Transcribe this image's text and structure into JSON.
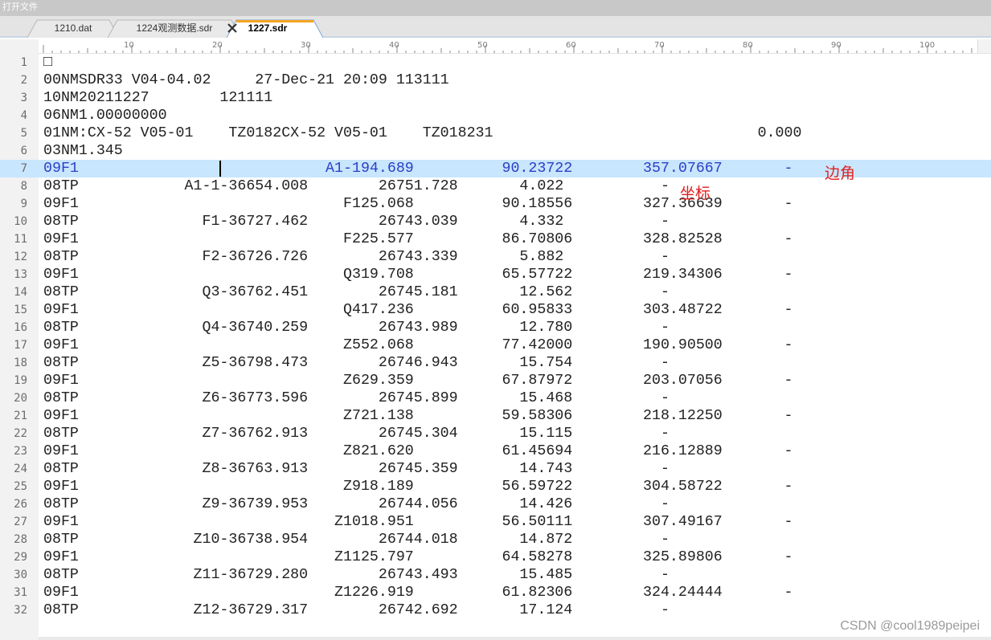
{
  "window": {
    "title": "打开文件"
  },
  "tabs": [
    {
      "label": "1210.dat",
      "active": false
    },
    {
      "label": "1224观测数据.sdr",
      "active": false
    },
    {
      "label": "1227.sdr",
      "active": true
    }
  ],
  "ruler": {
    "labels": [
      "10",
      "20",
      "30",
      "40",
      "50",
      "60",
      "70",
      "80",
      "90",
      "100"
    ]
  },
  "editor": {
    "current_line": 7,
    "lines": [
      {
        "num": "1",
        "text": "□"
      },
      {
        "num": "2",
        "text": "00NMSDR33 V04-04.02     27-Dec-21 20:09 113111"
      },
      {
        "num": "3",
        "text": "10NM20211227        121111"
      },
      {
        "num": "4",
        "text": "06NM1.00000000"
      },
      {
        "num": "5",
        "text": "01NM:CX-52 V05-01    TZ0182CX-52 V05-01    TZ018231                              0.000"
      },
      {
        "num": "6",
        "text": "03NM1.345"
      },
      {
        "num": "7",
        "text": "09F1                            A1-194.689          90.23722        357.07667       -"
      },
      {
        "num": "8",
        "text": "08TP            A1-1-36654.008        26751.728       4.022           -"
      },
      {
        "num": "9",
        "text": "09F1                              F125.068          90.18556        327.36639       -"
      },
      {
        "num": "10",
        "text": "08TP              F1-36727.462        26743.039       4.332           -"
      },
      {
        "num": "11",
        "text": "09F1                              F225.577          86.70806        328.82528       -"
      },
      {
        "num": "12",
        "text": "08TP              F2-36726.726        26743.339       5.882           -"
      },
      {
        "num": "13",
        "text": "09F1                              Q319.708          65.57722        219.34306       -"
      },
      {
        "num": "14",
        "text": "08TP              Q3-36762.451        26745.181       12.562          -"
      },
      {
        "num": "15",
        "text": "09F1                              Q417.236          60.95833        303.48722       -"
      },
      {
        "num": "16",
        "text": "08TP              Q4-36740.259        26743.989       12.780          -"
      },
      {
        "num": "17",
        "text": "09F1                              Z552.068          77.42000        190.90500       -"
      },
      {
        "num": "18",
        "text": "08TP              Z5-36798.473        26746.943       15.754          -"
      },
      {
        "num": "19",
        "text": "09F1                              Z629.359          67.87972        203.07056       -"
      },
      {
        "num": "20",
        "text": "08TP              Z6-36773.596        26745.899       15.468          -"
      },
      {
        "num": "21",
        "text": "09F1                              Z721.138          59.58306        218.12250       -"
      },
      {
        "num": "22",
        "text": "08TP              Z7-36762.913        26745.304       15.115          -"
      },
      {
        "num": "23",
        "text": "09F1                              Z821.620          61.45694        216.12889       -"
      },
      {
        "num": "24",
        "text": "08TP              Z8-36763.913        26745.359       14.743          -"
      },
      {
        "num": "25",
        "text": "09F1                              Z918.189          56.59722        304.58722       -"
      },
      {
        "num": "26",
        "text": "08TP              Z9-36739.953        26744.056       14.426          -"
      },
      {
        "num": "27",
        "text": "09F1                             Z1018.951          56.50111        307.49167       -"
      },
      {
        "num": "28",
        "text": "08TP             Z10-36738.954        26744.018       14.872          -"
      },
      {
        "num": "29",
        "text": "09F1                             Z1125.797          64.58278        325.89806       -"
      },
      {
        "num": "30",
        "text": "08TP             Z11-36729.280        26743.493       15.485          -"
      },
      {
        "num": "31",
        "text": "09F1                             Z1226.919          61.82306        324.24444       -"
      },
      {
        "num": "32",
        "text": "08TP             Z12-36729.317        26742.692       17.124          -"
      }
    ]
  },
  "annotations": {
    "edge_angle": "边角",
    "coordinate": "坐标"
  },
  "watermark": "CSDN @cool1989peipei"
}
